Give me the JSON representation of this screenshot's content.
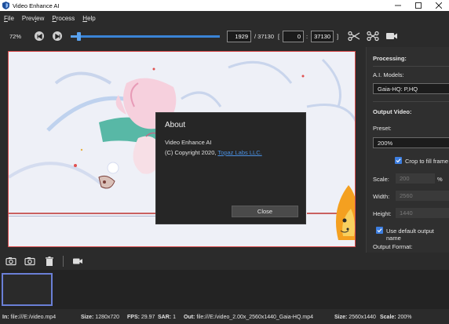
{
  "window": {
    "title": "Video Enhance AI"
  },
  "menu": {
    "items": [
      {
        "first": "F",
        "rest": "ile"
      },
      {
        "first": "Prev",
        "mid": "i",
        "rest": "ew"
      },
      {
        "first": "P",
        "rest": "rocess"
      },
      {
        "first": "H",
        "rest": "elp"
      }
    ]
  },
  "toolbar": {
    "zoom": "72%",
    "slider_progress_percent": 5.2,
    "current_frame": "1929",
    "total_frames": "/ 37130",
    "range_open": "[",
    "range_start": "0",
    "range_colon": ":",
    "range_end": "37130",
    "range_close": "]"
  },
  "about": {
    "title": "About",
    "app_name": "Video Enhance AI",
    "copyright": "(C) Copyright 2020,",
    "company_link": "Topaz Labs LLC.",
    "close_label": "Close"
  },
  "panel": {
    "processing_heading": "Processing:",
    "ai_models_label": "A.I. Models:",
    "ai_model_value": "Gaia-HQ: P,HQ",
    "output_heading": "Output Video:",
    "preset_label": "Preset:",
    "preset_value": "200%",
    "crop_label": "Crop to fill frame",
    "scale_label": "Scale:",
    "scale_value": "200",
    "scale_unit": "%",
    "width_label": "Width:",
    "width_value": "2560",
    "height_label": "Height:",
    "height_value": "1440",
    "default_name_label": "Use default output name",
    "format_label": "Output Format:"
  },
  "status": {
    "in_label": "In:",
    "in_value": "file:///E:/video.mp4",
    "size_label": "Size:",
    "size_value": "1280x720",
    "fps_label": "FPS:",
    "fps_value": "29.97",
    "sar_label": "SAR:",
    "sar_value": "1",
    "out_label": "Out:",
    "out_value": "file:///E:/video_2.00x_2560x1440_Gaia-HQ.mp4",
    "out_size_label": "Size:",
    "out_size_value": "2560x1440",
    "scale_label": "Scale:",
    "scale_value": "200%"
  },
  "colors": {
    "accent": "#3d7ee0",
    "link": "#4a90e2",
    "preview_border": "#d94a4a"
  }
}
